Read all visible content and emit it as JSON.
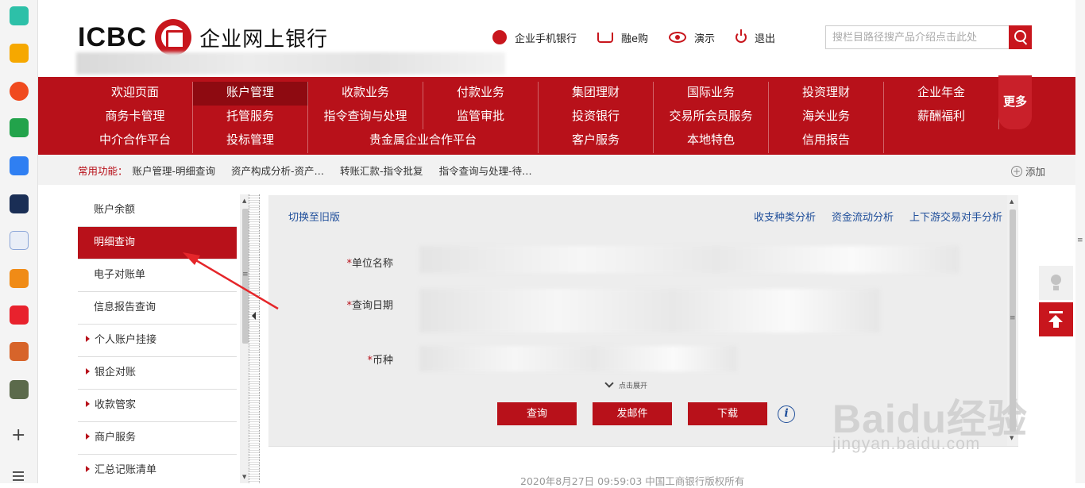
{
  "header": {
    "logo_letters": "ICBC",
    "logo_name": "企业网上银行",
    "top_links": [
      {
        "label": "企业手机银行",
        "icon": "mobile-bank-icon"
      },
      {
        "label": "融e购",
        "icon": "cart-icon"
      },
      {
        "label": "演示",
        "icon": "eye-icon"
      },
      {
        "label": "退出",
        "icon": "power-icon"
      }
    ],
    "search": {
      "placeholder": "搜栏目路径搜产品介绍点击此处"
    }
  },
  "nav": {
    "items": [
      {
        "label": "欢迎页面"
      },
      {
        "label": "账户管理",
        "active": true
      },
      {
        "label": "收款业务"
      },
      {
        "label": "付款业务"
      },
      {
        "label": "集团理财"
      },
      {
        "label": "国际业务"
      },
      {
        "label": "投资理财"
      },
      {
        "label": "企业年金"
      },
      {
        "label": "商务卡管理"
      },
      {
        "label": "托管服务"
      },
      {
        "label": "指令查询与处理"
      },
      {
        "label": "监管审批"
      },
      {
        "label": "投资银行"
      },
      {
        "label": "交易所会员服务"
      },
      {
        "label": "海关业务"
      },
      {
        "label": "薪酬福利"
      },
      {
        "label": "中介合作平台"
      },
      {
        "label": "投标管理"
      },
      {
        "label": "贵金属企业合作平台",
        "wide": true
      },
      {
        "label": "客户服务"
      },
      {
        "label": "本地特色"
      },
      {
        "label": "信用报告"
      }
    ],
    "more_label": "更多"
  },
  "quick": {
    "label": "常用功能：",
    "items": [
      "账户管理-明细查询",
      "资产构成分析-资产…",
      "转账汇款-指令批复",
      "指令查询与处理-待…"
    ],
    "add_label": "添加"
  },
  "sidebar": {
    "items": [
      {
        "label": "账户余额",
        "expandable": false,
        "active": false
      },
      {
        "label": "明细查询",
        "expandable": false,
        "active": true
      },
      {
        "label": "电子对账单",
        "expandable": false,
        "active": false
      },
      {
        "label": "信息报告查询",
        "expandable": false,
        "active": false
      },
      {
        "label": "个人账户挂接",
        "expandable": true,
        "active": false
      },
      {
        "label": "银企对账",
        "expandable": true,
        "active": false
      },
      {
        "label": "收款管家",
        "expandable": true,
        "active": false
      },
      {
        "label": "商户服务",
        "expandable": true,
        "active": false
      },
      {
        "label": "汇总记账清单",
        "expandable": true,
        "active": false
      }
    ]
  },
  "main": {
    "switch_label": "切换至旧版",
    "right_links": [
      "收支种类分析",
      "资金流动分析",
      "上下游交易对手分析"
    ],
    "fields": [
      {
        "required": "*",
        "label": "单位名称"
      },
      {
        "required": "*",
        "label": "查询日期"
      },
      {
        "required": "*",
        "label": "币种"
      }
    ],
    "expand_label": "点击展开",
    "buttons": {
      "query": "查询",
      "email": "发邮件",
      "download": "下载"
    },
    "info_glyph": "i",
    "footer": "2020年8月27日 09:59:03   中国工商银行版权所有"
  },
  "watermark": {
    "line1": "Baidu经验",
    "line2": "jingyan.baidu.com"
  },
  "colors": {
    "brand_red": "#b8111a",
    "link_blue": "#1f4e9a"
  }
}
